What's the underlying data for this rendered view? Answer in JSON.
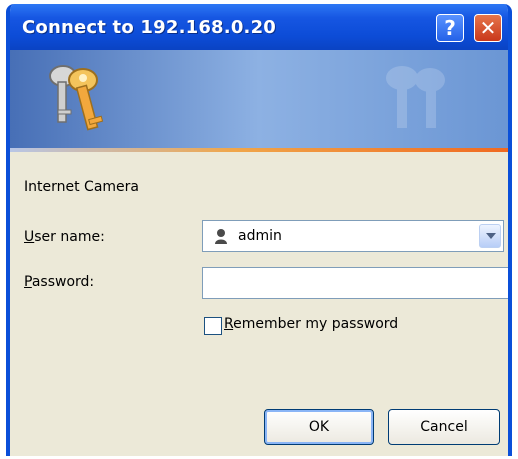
{
  "dialog": {
    "title": "Connect to 192.168.0.20",
    "help_button": "?",
    "close_button": "✕",
    "realm": "Internet Camera",
    "user_label_u": "U",
    "user_label_rest": "ser name:",
    "password_label_u": "P",
    "password_label_rest": "assword:",
    "user_value": "admin",
    "password_value": "",
    "remember_u": "R",
    "remember_rest": "emember my password",
    "ok_button": "OK",
    "cancel_button": "Cancel",
    "colors": {
      "title_blue": "#0a4fd9",
      "dialog_bg": "#ece9d8",
      "accent_orange": "#f06a21"
    }
  }
}
